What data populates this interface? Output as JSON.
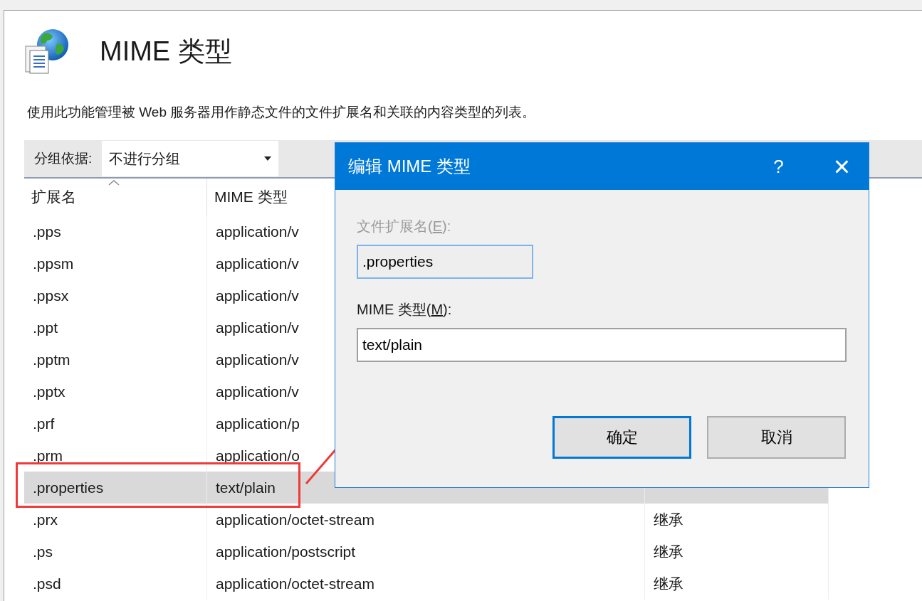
{
  "page": {
    "title": "MIME 类型",
    "description": "使用此功能管理被 Web 服务器用作静态文件的文件扩展名和关联的内容类型的列表。"
  },
  "toolbar": {
    "group_label": "分组依据:",
    "group_value": "不进行分组"
  },
  "table": {
    "columns": [
      {
        "label": "扩展名",
        "sorted": true
      },
      {
        "label": "MIME 类型",
        "sorted": false
      }
    ],
    "rows": [
      {
        "extension": ".pps",
        "mime_type": "application/v",
        "selected": false
      },
      {
        "extension": ".ppsm",
        "mime_type": "application/v",
        "selected": false
      },
      {
        "extension": ".ppsx",
        "mime_type": "application/v",
        "selected": false
      },
      {
        "extension": ".ppt",
        "mime_type": "application/v",
        "selected": false
      },
      {
        "extension": ".pptm",
        "mime_type": "application/v",
        "selected": false
      },
      {
        "extension": ".pptx",
        "mime_type": "application/v",
        "selected": false
      },
      {
        "extension": ".prf",
        "mime_type": "application/p",
        "selected": false
      },
      {
        "extension": ".prm",
        "mime_type": "application/o",
        "selected": false
      },
      {
        "extension": ".properties",
        "mime_type": "text/plain",
        "selected": true
      },
      {
        "extension": ".prx",
        "mime_type": "application/octet-stream",
        "entry_type": "继承",
        "selected": false
      },
      {
        "extension": ".ps",
        "mime_type": "application/postscript",
        "entry_type": "继承",
        "selected": false
      },
      {
        "extension": ".psd",
        "mime_type": "application/octet-stream",
        "entry_type": "继承",
        "selected": false
      }
    ]
  },
  "dialog": {
    "title": "编辑 MIME 类型",
    "help": "?",
    "close": "×",
    "extension_label": "文件扩展名(",
    "extension_key": "E",
    "extension_label_end": "):",
    "extension_value": ".properties",
    "extension_disabled": true,
    "mime_label": "MIME 类型(",
    "mime_key": "M",
    "mime_label_end": "):",
    "mime_value": "text/plain",
    "buttons": [
      {
        "label": "确定",
        "default": true
      },
      {
        "label": "取消",
        "default": false
      }
    ]
  }
}
